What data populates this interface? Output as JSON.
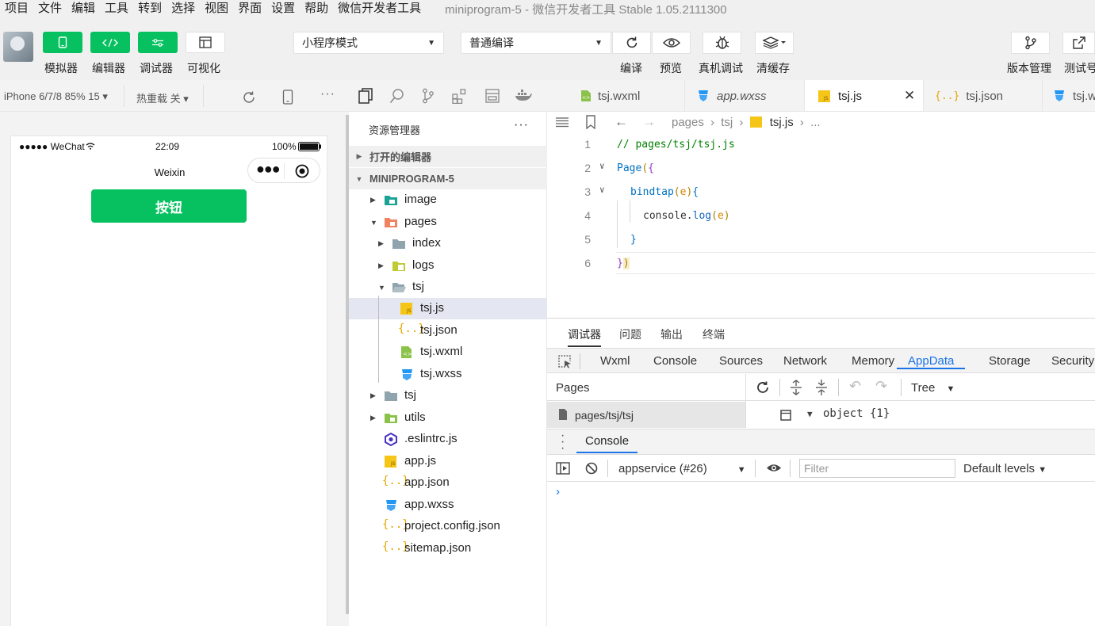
{
  "menu": {
    "items": [
      "项目",
      "文件",
      "编辑",
      "工具",
      "转到",
      "选择",
      "视图",
      "界面",
      "设置",
      "帮助",
      "微信开发者工具"
    ],
    "window_title": "miniprogram-5 - 微信开发者工具 Stable 1.05.2111300"
  },
  "toolbar": {
    "simulator_label": "模拟器",
    "editor_label": "编辑器",
    "debugger_label": "调试器",
    "visual_label": "可视化",
    "mode_select": "小程序模式",
    "compile_select": "普通编译",
    "compile_label": "编译",
    "preview_label": "预览",
    "realdebug_label": "真机调试",
    "clearcache_label": "清缓存",
    "version_label": "版本管理",
    "test_label": "测试号"
  },
  "simulator": {
    "device": "iPhone 6/7/8 85% 15 ▾",
    "hotreload": "热重载 关 ▾",
    "status_carrier": "●●●●● WeChat",
    "status_time": "22:09",
    "status_battery": "100%",
    "nav_title": "Weixin",
    "button_label": "按钮"
  },
  "explorer": {
    "title": "资源管理器",
    "menu": "···",
    "open_editors": "打开的编辑器",
    "project": "MINIPROGRAM-5",
    "tree": [
      {
        "name": "image",
        "icon": "image-folder-icon"
      },
      {
        "name": "pages",
        "icon": "pages-folder-icon"
      },
      {
        "name": "index",
        "icon": "folder-icon"
      },
      {
        "name": "logs",
        "icon": "logs-folder-icon"
      },
      {
        "name": "tsj",
        "icon": "folder-open-icon"
      },
      {
        "name": "tsj.js",
        "icon": "js-file-icon"
      },
      {
        "name": "tsj.json",
        "icon": "json-file-icon"
      },
      {
        "name": "tsj.wxml",
        "icon": "wxml-file-icon"
      },
      {
        "name": "tsj.wxss",
        "icon": "wxss-file-icon"
      },
      {
        "name": "tsj",
        "icon": "folder-icon"
      },
      {
        "name": "utils",
        "icon": "utils-folder-icon"
      },
      {
        "name": ".eslintrc.js",
        "icon": "eslint-file-icon"
      },
      {
        "name": "app.js",
        "icon": "js-file-icon"
      },
      {
        "name": "app.json",
        "icon": "json-file-icon"
      },
      {
        "name": "app.wxss",
        "icon": "wxss-file-icon"
      },
      {
        "name": "project.config.json",
        "icon": "json-file-icon"
      },
      {
        "name": "sitemap.json",
        "icon": "json-file-icon"
      }
    ]
  },
  "editor": {
    "tabs": [
      "tsj.wxml",
      "app.wxss",
      "tsj.js",
      "tsj.json",
      "tsj.wxss"
    ],
    "active_tab": "tsj.js",
    "breadcrumb": [
      "pages",
      "tsj",
      "tsj.js",
      "..."
    ],
    "lines": [
      "1",
      "2",
      "3",
      "4",
      "5",
      "6"
    ],
    "code": {
      "l1": "// pages/tsj/tsj.js",
      "l2a": "Page",
      "l2b": "(",
      "l2c": "{",
      "l3a": "bindtap",
      "l3b": "(",
      "l3c": "e",
      "l3d": ")",
      "l3e": "{",
      "l4a": "console.",
      "l4b": "log",
      "l4c": "(",
      "l4d": "e",
      "l4e": ")",
      "l5": "}",
      "l6a": "}",
      "l6b": ")"
    }
  },
  "debugger": {
    "panel_tabs": [
      "调试器",
      "问题",
      "输出",
      "终端"
    ],
    "dev_tabs": [
      "Wxml",
      "Console",
      "Sources",
      "Network",
      "Memory",
      "AppData",
      "Storage",
      "Security"
    ],
    "active_dev_tab": "AppData",
    "pages_label": "Pages",
    "tree_label": "Tree",
    "page_path": "pages/tsj/tsj",
    "object_text": "object {1}",
    "console_label": "Console",
    "context": "appservice (#26)",
    "filter_placeholder": "Filter",
    "levels": "Default levels",
    "prompt": "›"
  },
  "colors": {
    "wechat_green": "#07c160",
    "accent_blue": "#1a73e8"
  }
}
